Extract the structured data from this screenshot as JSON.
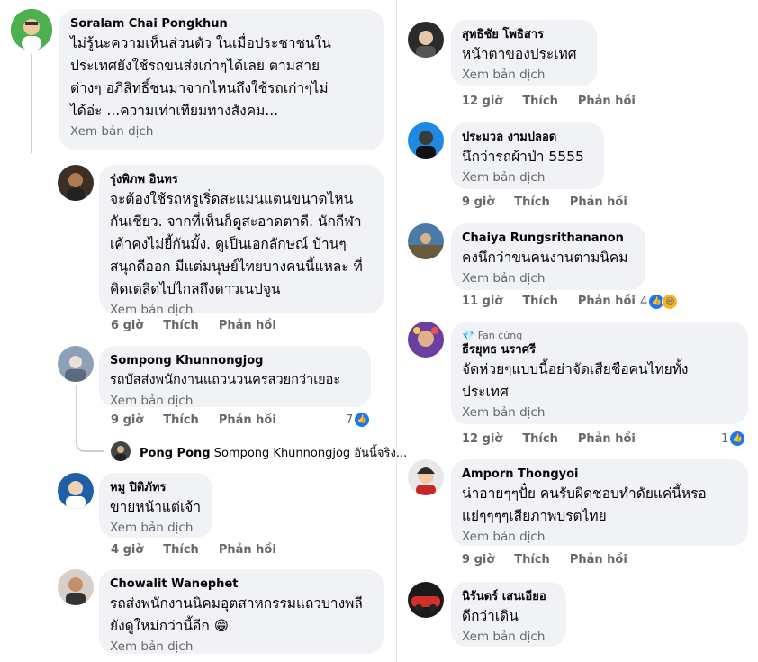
{
  "translate_label": "Xem bản dịch",
  "like_label": "Thích",
  "reply_label": "Phản hồi",
  "left": {
    "main": {
      "author": "Soralam Chai Pongkhun",
      "text": "ไม่รู้นะความเห็นส่วนตัว ในเมื่อประชาชนใน\nประเทศยังใช้รถขนส่งเก่าๆได้เลย ตามสาย\nต่างๆ อภิสิทธิ์ชนมาจากไหนถึงใช้รถเก่าๆไม่\nได้อ่ะ ...ความเท่าเทียมทางสังคม..."
    },
    "replies": [
      {
        "author": "รุ่งพิภพ อินทร",
        "text": "จะต้องใช้รถหรูเริ่ดสะแมนแตนขนาดไหน\nกันเชียว. จากที่เห็นก็ดูสะอาดตาดี. นักกีฬา\nเค้าคงไม่ยี้กันมั้ง. ดูเป็นเอกลักษณ์ บ้านๆ\nสนุกดีออก มีแต่มนุษย์ไทยบางคนนี้แหละ ที่\nคิดเตลิดไปไกลถึงดาวเนปจูน",
        "time": "6 giờ"
      },
      {
        "author": "Sompong Khunnongjog",
        "text": "รถบัสส่งพนักงานแถวนวนครสวยกว่าเยอะ",
        "time": "9 giờ",
        "reactions": "7"
      },
      {
        "author": "หมู ปิติภัทร",
        "text": "ขายหน้าแต่เจ้า",
        "time": "4 giờ"
      },
      {
        "author": "Chowalit Wanephet",
        "text": "รถส่งพนักงานนิคมอุตสาหกรรมแถวบางพลี\nยังดูใหม่กว่านี้อีก 😁"
      }
    ],
    "nested_reply": {
      "author": "Pong Pong",
      "text": "Sompong Khunnongjog อันนี้จริง..."
    }
  },
  "right": [
    {
      "author": "สุทธิชัย โพธิสาร",
      "text": "หน้าตาของประเทศ",
      "time": "12 giờ"
    },
    {
      "author": "ประมวล งามปลอด",
      "text": "นึกว่ารถผ้าป่า  5555",
      "time": "9 giờ"
    },
    {
      "author": "Chaiya Rungsrithananon",
      "text": "คงนึกว่าขนคนงานตามนิคม",
      "time": "11 giờ",
      "reactions": "4"
    },
    {
      "badge": "Fan cứng",
      "author": "ธีรยุทธ นราศรี",
      "text": "จัดห่วยๆแบบนี้อย่าจัดเสียชื่อคนไทยทั้ง\nประเทศ",
      "time": "12 giờ",
      "reactions": "1"
    },
    {
      "author": "Amporn Thongyoi",
      "text": "น่าอายๆๆปั๋ย  คนรับผิดชอบทำดัยแค่นี้หรอ\nแย่ๆๆๆๆเสียภาพบรตไทย",
      "time": "9 giờ"
    },
    {
      "author": "นิรันดร์ เสนเอียอ",
      "text": "ดีกว่าเดิน"
    }
  ]
}
